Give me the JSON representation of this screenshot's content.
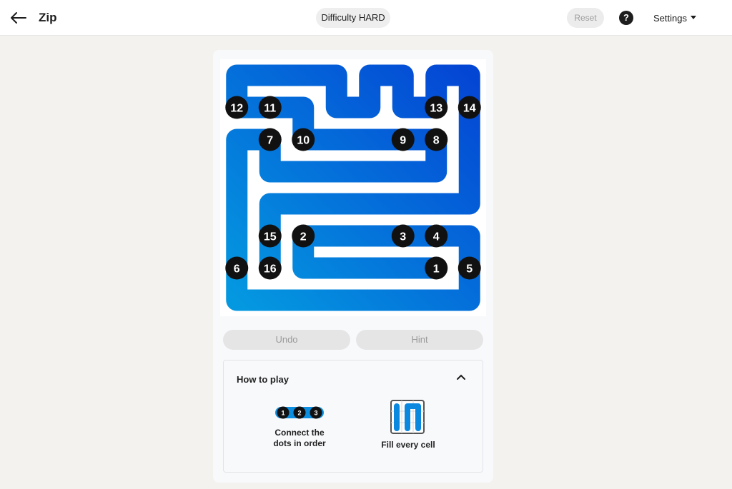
{
  "header": {
    "app_title": "Zip",
    "difficulty_label": "Difficulty HARD",
    "reset_label": "Reset",
    "help_symbol": "?",
    "settings_label": "Settings"
  },
  "board": {
    "cols": 8,
    "rows": 8,
    "path_start_color": "#0498e0",
    "path_end_color": "#0446d4",
    "dots": [
      {
        "label": "1",
        "col": 6,
        "row": 6
      },
      {
        "label": "2",
        "col": 2,
        "row": 5
      },
      {
        "label": "3",
        "col": 5,
        "row": 5
      },
      {
        "label": "4",
        "col": 6,
        "row": 5
      },
      {
        "label": "5",
        "col": 7,
        "row": 6
      },
      {
        "label": "6",
        "col": 0,
        "row": 6
      },
      {
        "label": "7",
        "col": 1,
        "row": 2
      },
      {
        "label": "8",
        "col": 6,
        "row": 2
      },
      {
        "label": "9",
        "col": 5,
        "row": 2
      },
      {
        "label": "10",
        "col": 2,
        "row": 2
      },
      {
        "label": "11",
        "col": 1,
        "row": 1
      },
      {
        "label": "12",
        "col": 0,
        "row": 1
      },
      {
        "label": "13",
        "col": 6,
        "row": 1
      },
      {
        "label": "14",
        "col": 7,
        "row": 1
      },
      {
        "label": "15",
        "col": 1,
        "row": 5
      },
      {
        "label": "16",
        "col": 1,
        "row": 6
      }
    ],
    "path": [
      [
        6,
        6
      ],
      [
        5,
        6
      ],
      [
        4,
        6
      ],
      [
        3,
        6
      ],
      [
        2,
        6
      ],
      [
        2,
        5
      ],
      [
        3,
        5
      ],
      [
        4,
        5
      ],
      [
        5,
        5
      ],
      [
        6,
        5
      ],
      [
        7,
        5
      ],
      [
        7,
        6
      ],
      [
        7,
        7
      ],
      [
        6,
        7
      ],
      [
        5,
        7
      ],
      [
        4,
        7
      ],
      [
        3,
        7
      ],
      [
        2,
        7
      ],
      [
        1,
        7
      ],
      [
        0,
        7
      ],
      [
        0,
        6
      ],
      [
        0,
        5
      ],
      [
        0,
        4
      ],
      [
        0,
        3
      ],
      [
        0,
        2
      ],
      [
        1,
        2
      ],
      [
        1,
        3
      ],
      [
        2,
        3
      ],
      [
        3,
        3
      ],
      [
        4,
        3
      ],
      [
        5,
        3
      ],
      [
        6,
        3
      ],
      [
        6,
        2
      ],
      [
        5,
        2
      ],
      [
        4,
        2
      ],
      [
        3,
        2
      ],
      [
        2,
        2
      ],
      [
        2,
        1
      ],
      [
        1,
        1
      ],
      [
        0,
        1
      ],
      [
        0,
        0
      ],
      [
        1,
        0
      ],
      [
        2,
        0
      ],
      [
        3,
        0
      ],
      [
        3,
        1
      ],
      [
        4,
        1
      ],
      [
        4,
        0
      ],
      [
        5,
        0
      ],
      [
        5,
        1
      ],
      [
        6,
        1
      ],
      [
        6,
        0
      ],
      [
        7,
        0
      ],
      [
        7,
        1
      ],
      [
        7,
        2
      ],
      [
        7,
        3
      ],
      [
        7,
        4
      ],
      [
        6,
        4
      ],
      [
        5,
        4
      ],
      [
        4,
        4
      ],
      [
        3,
        4
      ],
      [
        2,
        4
      ],
      [
        1,
        4
      ],
      [
        1,
        5
      ],
      [
        1,
        6
      ]
    ]
  },
  "controls": {
    "undo_label": "Undo",
    "hint_label": "Hint"
  },
  "how_to_play": {
    "title": "How to play",
    "example_dots": [
      "1",
      "2",
      "3"
    ],
    "step1_line1": "Connect the",
    "step1_line2": "dots in order",
    "step2": "Fill every cell"
  }
}
